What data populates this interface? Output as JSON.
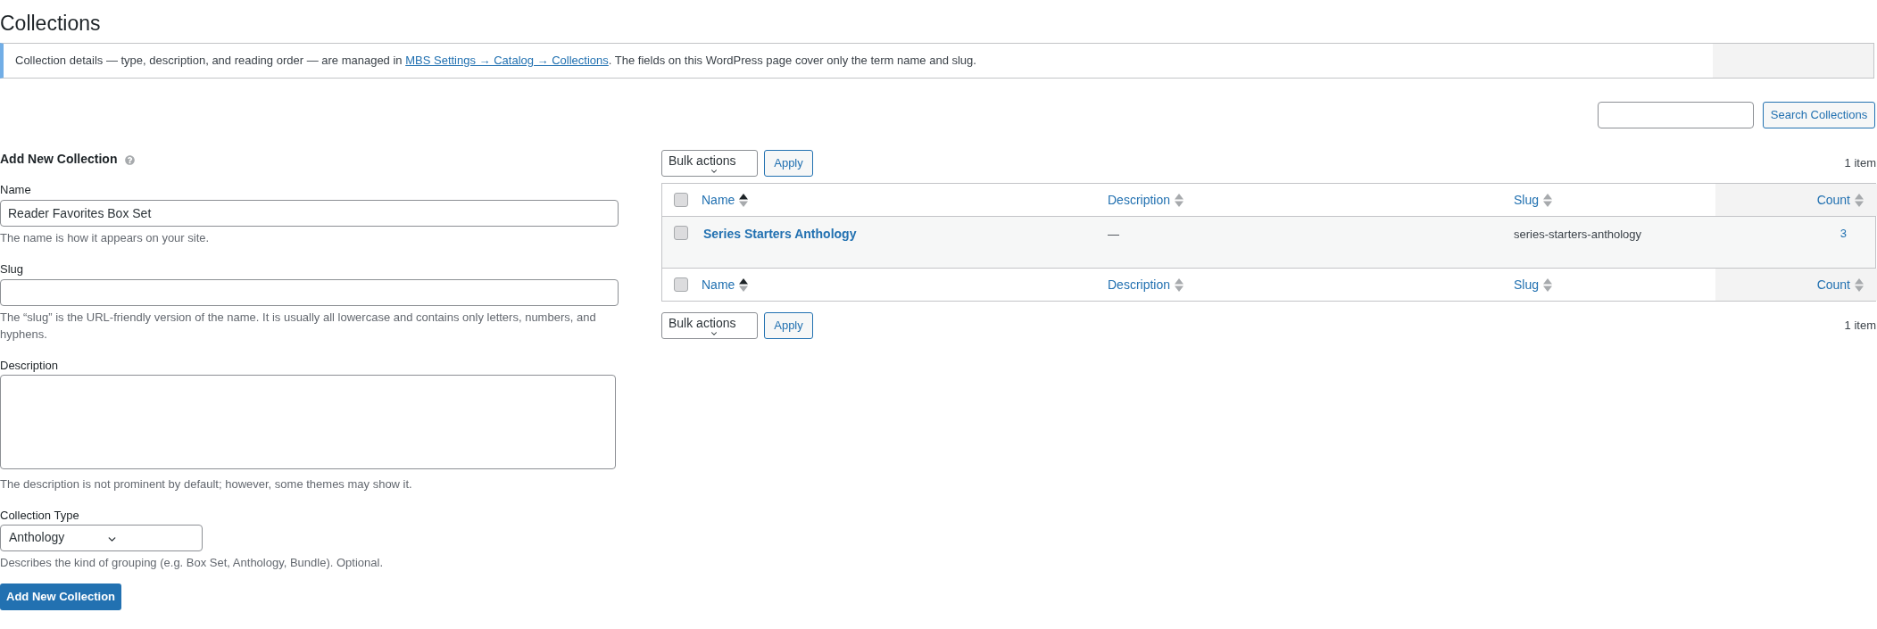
{
  "page": {
    "title": "Collections"
  },
  "notice": {
    "text_before": "Collection details — type, description, and reading order — are managed in ",
    "link": "MBS Settings → Catalog → Collections",
    "text_after": ". The fields on this WordPress page cover only the term name and slug."
  },
  "search": {
    "button": "Search Collections"
  },
  "add_form": {
    "heading": "Add New Collection",
    "fields": [
      {
        "kind": "text",
        "label": "Name",
        "value": "Reader Favorites Box Set",
        "hint": "The name is how it appears on your site."
      },
      {
        "kind": "text",
        "label": "Slug",
        "hint": "The “slug” is the URL-friendly version of the name. It is usually all lowercase and contains only letters, numbers, and hyphens."
      },
      {
        "kind": "textarea",
        "label": "Description",
        "hint": "The description is not prominent by default; however, some themes may show it."
      },
      {
        "kind": "select",
        "label": "Collection Type",
        "value": "Anthology",
        "hint": "Describes the kind of grouping (e.g. Box Set, Anthology, Bundle). Optional."
      }
    ],
    "submit": "Add New Collection"
  },
  "table": {
    "top_nav": {
      "bulk_actions": "Bulk actions",
      "apply": "Apply",
      "count": "1 item"
    },
    "header": {
      "checked": false,
      "columns": [
        {
          "label": "Name",
          "sorted": true,
          "highlighted": false
        },
        {
          "label": "Description",
          "sorted": false,
          "highlighted": false
        },
        {
          "label": "Slug",
          "sorted": false,
          "highlighted": false
        },
        {
          "label": "Count",
          "sorted": false,
          "highlighted": true
        }
      ]
    },
    "rows": [
      {
        "checked": false,
        "name": "Series Starters Anthology",
        "description": "—",
        "slug": "series-starters-anthology",
        "count": "3"
      }
    ],
    "footer": {
      "checked": false,
      "columns": [
        {
          "label": "Name",
          "sorted": true,
          "highlighted": false
        },
        {
          "label": "Description",
          "sorted": false,
          "highlighted": false
        },
        {
          "label": "Slug",
          "sorted": false,
          "highlighted": false
        },
        {
          "label": "Count",
          "sorted": false,
          "highlighted": true
        }
      ]
    },
    "bottom_nav": {
      "bulk_actions": "Bulk actions",
      "apply": "Apply",
      "count": "1 item"
    }
  }
}
